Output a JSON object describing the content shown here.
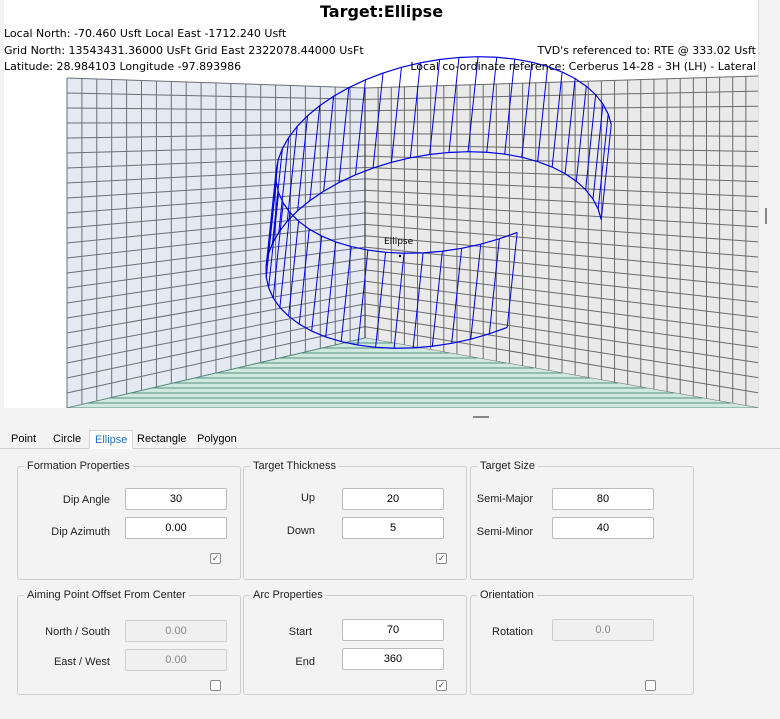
{
  "viewer": {
    "title": "Target:Ellipse",
    "info_left": [
      "Local North: -70.460 Usft Local East -1712.240 Usft",
      "Grid North: 13543431.36000 UsFt Grid East 2322078.44000 UsFt",
      "Latitude: 28.984103 Longitude -97.893986"
    ],
    "info_right": [
      "TVD's referenced to: RTE @ 333.02 Usft",
      "Local co-ordinate reference: Cerberus 14-28 - 3H (LH) - Lateral"
    ],
    "target_label": "Ellipse",
    "ellipse_color": "#0000e0"
  },
  "tabs": [
    {
      "label": "Point",
      "active": false
    },
    {
      "label": "Circle",
      "active": false
    },
    {
      "label": "Ellipse",
      "active": true
    },
    {
      "label": "Rectangle",
      "active": false
    },
    {
      "label": "Polygon",
      "active": false
    }
  ],
  "formation": {
    "title": "Formation Properties",
    "dip_angle_label": "Dip Angle",
    "dip_angle": "30",
    "dip_azimuth_label": "Dip Azimuth",
    "dip_azimuth": "0.00",
    "checked": true
  },
  "thickness": {
    "title": "Target Thickness",
    "up_label": "Up",
    "up": "20",
    "down_label": "Down",
    "down": "5",
    "checked": true
  },
  "size": {
    "title": "Target Size",
    "semi_major_label": "Semi-Major",
    "semi_major": "80",
    "semi_minor_label": "Semi-Minor",
    "semi_minor": "40"
  },
  "aiming": {
    "title": "Aiming Point Offset From Center",
    "ns_label": "North / South",
    "ns": "0.00",
    "ew_label": "East / West",
    "ew": "0.00",
    "checked": false
  },
  "arc": {
    "title": "Arc Properties",
    "start_label": "Start",
    "start": "70",
    "end_label": "End",
    "end": "360",
    "checked": true
  },
  "orientation": {
    "title": "Orientation",
    "rotation_label": "Rotation",
    "rotation": "0.0",
    "checked": false
  }
}
